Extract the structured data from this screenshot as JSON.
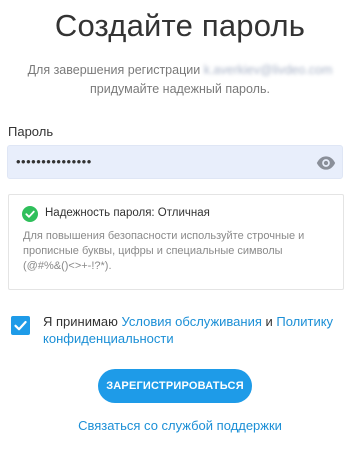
{
  "page": {
    "title": "Создайте пароль",
    "subtitle_line1": "Для завершения регистрации",
    "masked_email": "k.averkiev@livdeo.com",
    "subtitle_line2": "придумайте надежный пароль."
  },
  "password": {
    "label": "Пароль",
    "value": "•••••••••••••••",
    "toggle_icon": "eye-icon"
  },
  "strength": {
    "status_icon": "check-circle-icon",
    "status_color": "#2fbf5b",
    "text": "Надежность пароля: Отличная",
    "hint": "Для повышения безопасности используйте строчные и прописные буквы, цифры и специальные символы (@#%&()<>+-!?*)."
  },
  "terms": {
    "checked": true,
    "prefix": "Я принимаю ",
    "terms_link": "Условия обслуживания",
    "conjunction": " и ",
    "privacy_link": "Политику конфиденциальности"
  },
  "actions": {
    "register_label": "ЗАРЕГИСТРИРОВАТЬСЯ",
    "support_link": "Связаться со службой поддержки"
  },
  "colors": {
    "accent": "#1e9be8",
    "link": "#1b8fd6",
    "input_bg": "#e8eefb"
  }
}
